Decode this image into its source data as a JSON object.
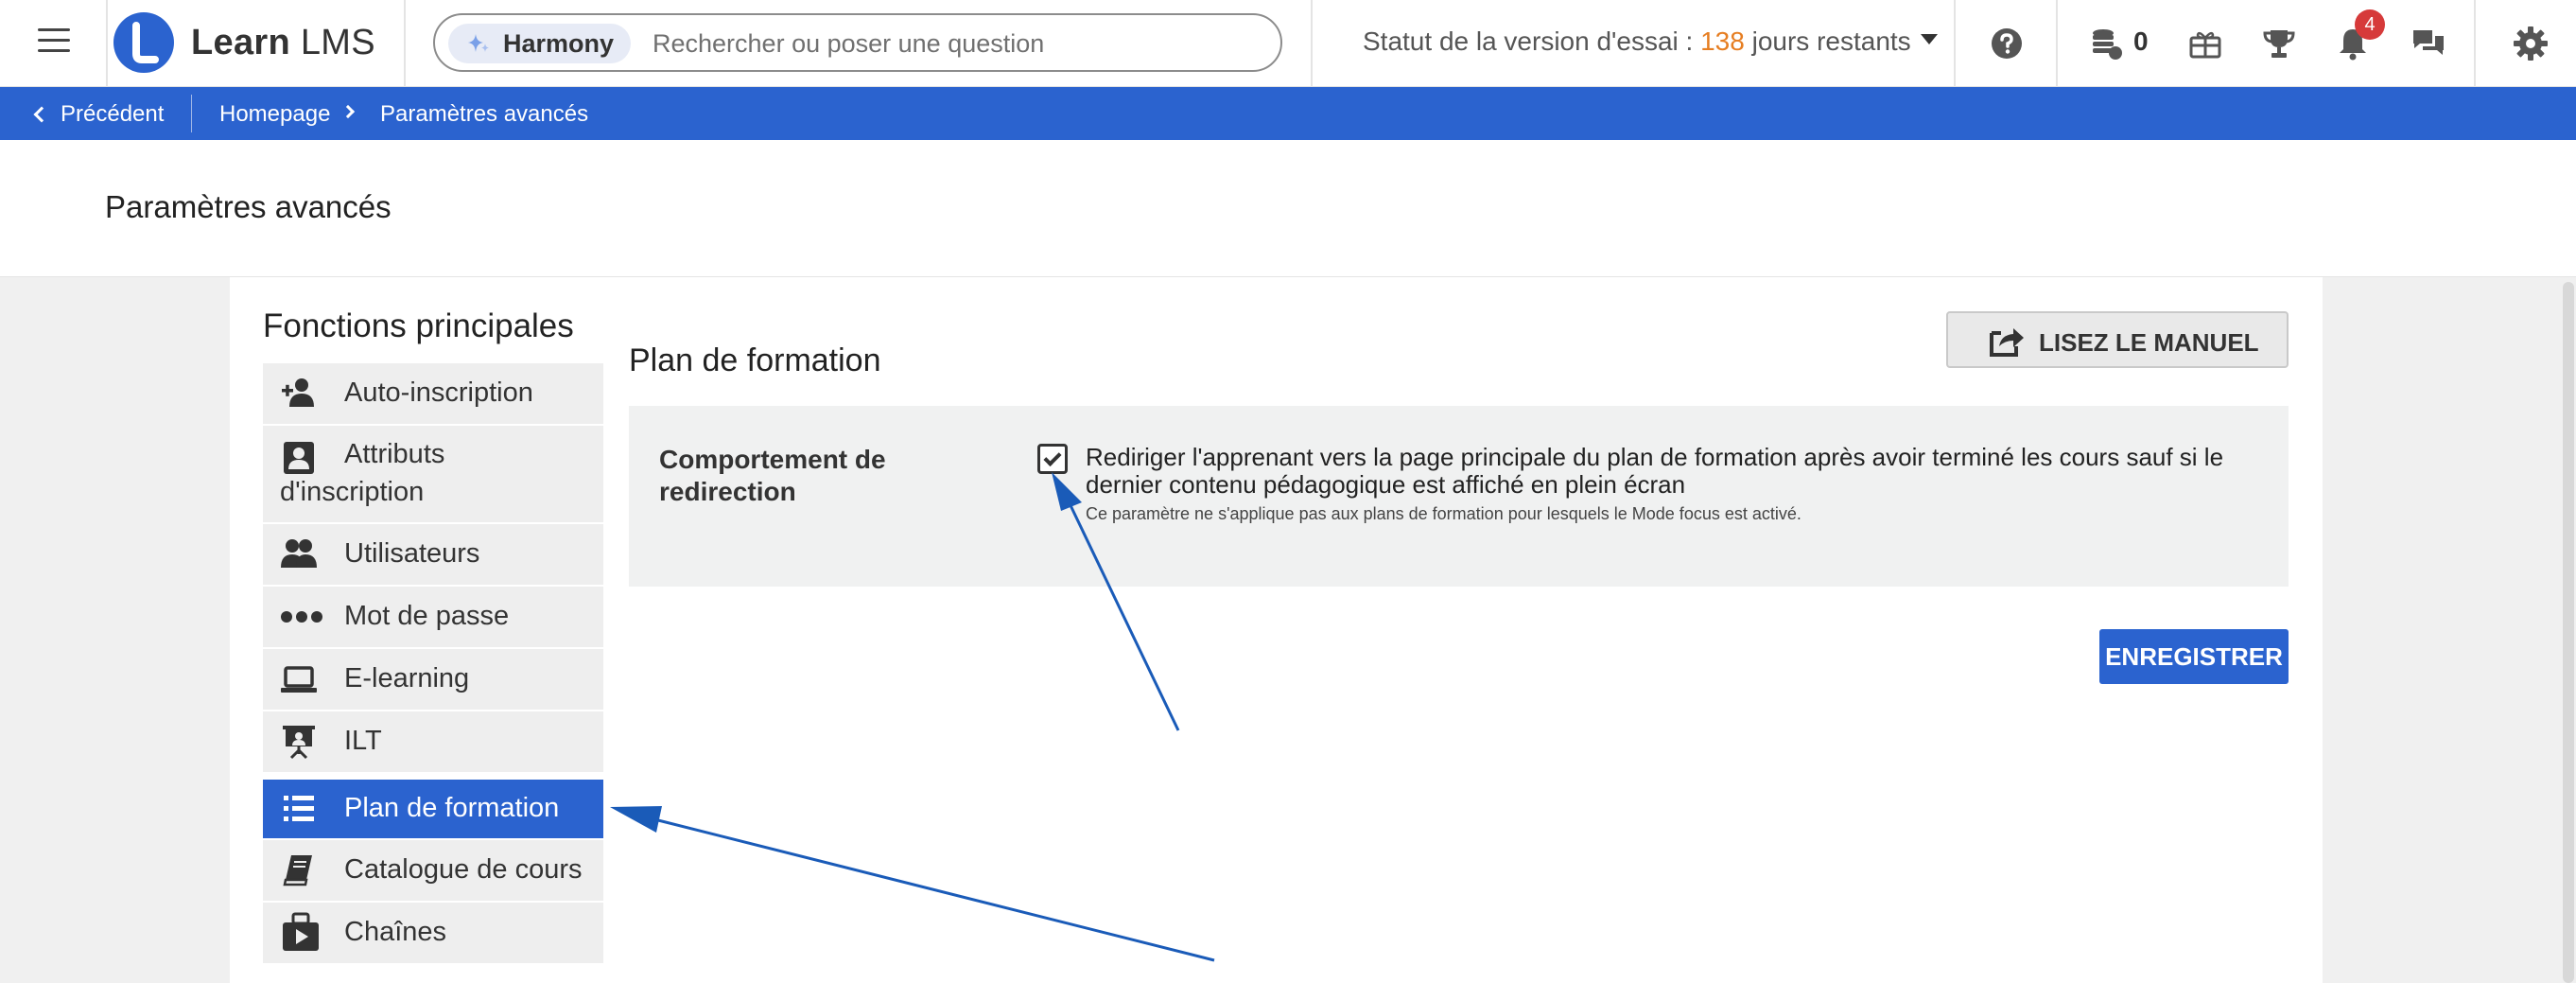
{
  "topbar": {
    "brand_bold": "Learn",
    "brand_rest": " LMS",
    "search": {
      "pill_label": "Harmony",
      "placeholder": "Rechercher ou poser une question"
    },
    "trial": {
      "prefix": "Statut de la version d'essai : ",
      "days": "138",
      "suffix": " jours restants"
    },
    "coins": "0",
    "notifications": "4",
    "icons": [
      "menu-icon",
      "help-icon",
      "coins-icon",
      "gift-icon",
      "trophy-icon",
      "bell-icon",
      "chat-icon",
      "gear-icon"
    ]
  },
  "breadcrumb": {
    "back": "Précédent",
    "home": "Homepage",
    "current": "Paramètres avancés"
  },
  "page": {
    "title": "Paramètres avancés"
  },
  "sidebar": {
    "heading": "Fonctions principales",
    "items": [
      {
        "label": "Auto-inscription",
        "icon": "user-plus-icon"
      },
      {
        "label": "Attributs d'inscription",
        "icon": "id-card-icon"
      },
      {
        "label": "Utilisateurs",
        "icon": "users-icon"
      },
      {
        "label": "Mot de passe",
        "icon": "dots-icon"
      },
      {
        "label": "E-learning",
        "icon": "laptop-icon"
      },
      {
        "label": "ILT",
        "icon": "presentation-icon"
      },
      {
        "label": "Plan de formation",
        "icon": "list-icon",
        "active": true
      },
      {
        "label": "Catalogue de cours",
        "icon": "book-icon"
      },
      {
        "label": "Chaînes",
        "icon": "channels-icon"
      }
    ]
  },
  "main": {
    "section_title": "Plan de formation",
    "manual_button": "LISEZ LE MANUEL",
    "setting": {
      "label": "Comportement de redirection",
      "checked": true,
      "text": "Rediriger l'apprenant vers la page principale du plan de formation après avoir terminé les cours sauf si le dernier contenu pédagogique est affiché en plein écran",
      "hint": "Ce paramètre ne s'applique pas aux plans de formation pour lesquels le Mode focus est activé."
    },
    "save_button": "ENREGISTRER"
  },
  "colors": {
    "primary": "#2b63cf",
    "trial_days": "#e67e22",
    "badge": "#d63a3a",
    "annotation_arrow": "#1a5bb8"
  }
}
